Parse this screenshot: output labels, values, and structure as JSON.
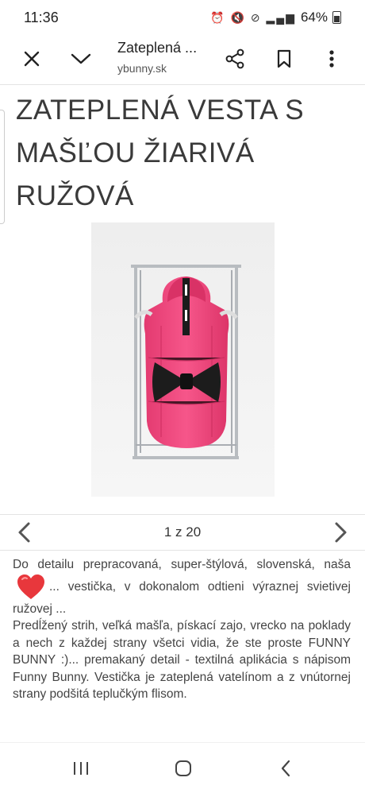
{
  "status_bar": {
    "time": "11:36",
    "battery": "64%"
  },
  "toolbar": {
    "title": "Zateplená ...",
    "url": "ybunny.sk"
  },
  "product": {
    "title": "ZATEPLENÁ VESTA S MAŠĽOU ŽIARIVÁ RUŽOVÁ"
  },
  "pager": {
    "count": "1 z 20"
  },
  "description": {
    "line1": "Do detailu prepracovaná, super-štýlová, slovenská, naša",
    "line1_end": "... vestička, v dokonalom odtieni výraznej svietivej ružovej ...",
    "paragraph2": "Predĺžený strih, veľká mašľa, pískací zajo, vrecko na poklady a nech z každej strany všetci vidia, že ste proste FUNNY BUNNY :)... premakaný detail - textilná aplikácia s nápisom Funny Bunny. Vestička je zateplená vatelínom a z vnútornej strany podšitá teplučkým flisom."
  },
  "icons": {
    "close": "close-icon",
    "collapse": "chevron-down-icon",
    "share": "share-icon",
    "bookmark": "bookmark-icon",
    "menu": "more-vertical-icon",
    "prev": "chevron-left-icon",
    "next": "chevron-right-icon",
    "heart": "heart-emoji-icon"
  },
  "colors": {
    "vest_pink": "#f2467e",
    "bow_black": "#1c1c1c"
  }
}
